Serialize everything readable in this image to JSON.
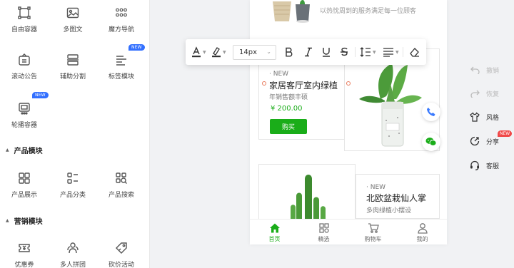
{
  "components": {
    "row1": [
      {
        "label": "自由容器",
        "icon": "free-container-icon"
      },
      {
        "label": "多图文",
        "icon": "multi-image-text-icon"
      },
      {
        "label": "魔方导航",
        "icon": "cube-nav-icon"
      }
    ],
    "row2": [
      {
        "label": "滚动公告",
        "icon": "notice-icon"
      },
      {
        "label": "辅助分割",
        "icon": "divider-icon"
      },
      {
        "label": "标签模块",
        "icon": "tag-module-icon",
        "badge": "NEW"
      }
    ],
    "row3": [
      {
        "label": "轮播容器",
        "icon": "carousel-icon",
        "badge": "NEW"
      }
    ]
  },
  "sections": [
    {
      "title": "产品模块",
      "items": [
        {
          "label": "产品展示",
          "icon": "product-grid-icon"
        },
        {
          "label": "产品分类",
          "icon": "product-category-icon"
        },
        {
          "label": "产品搜索",
          "icon": "product-search-icon"
        }
      ]
    },
    {
      "title": "营销模块",
      "items": [
        {
          "label": "优惠券",
          "icon": "coupon-icon"
        },
        {
          "label": "多人拼团",
          "icon": "group-buy-icon"
        },
        {
          "label": "砍价活动",
          "icon": "bargain-icon"
        }
      ]
    }
  ],
  "phone": {
    "banner_text": "以热忱周到的服务满足每一位顾客",
    "product1": {
      "new_tag": "· NEW",
      "title": "家居客厅室内绿植",
      "subtitle": "年销售额丰硕",
      "price": "¥ 200.00",
      "buy": "购买"
    },
    "product2": {
      "new_tag": "· NEW",
      "title": "北欧盆栽仙人掌",
      "subtitle": "多肉绿植小摆设"
    },
    "tabs": [
      {
        "label": "首页",
        "icon": "home-icon",
        "active": true
      },
      {
        "label": "精选",
        "icon": "grid-icon",
        "active": false
      },
      {
        "label": "购物车",
        "icon": "cart-icon",
        "active": false
      },
      {
        "label": "我的",
        "icon": "user-icon",
        "active": false
      }
    ]
  },
  "toolbar": {
    "font_size": "14px"
  },
  "right_panel": {
    "undo": "撤销",
    "redo": "恢复",
    "style": "风格",
    "share": "分享",
    "share_badge": "NEW",
    "service": "客服"
  },
  "colors": {
    "accent_green": "#1aad19",
    "badge_blue": "#3370ff",
    "badge_red": "#f04848"
  }
}
